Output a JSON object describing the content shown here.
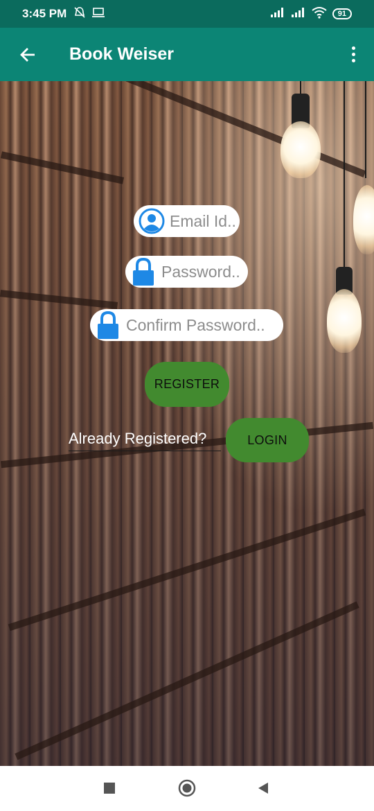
{
  "status_bar": {
    "time": "3:45 PM",
    "battery": "91",
    "icons": [
      "alarm-off-icon",
      "laptop-icon",
      "signal-icon",
      "signal-icon",
      "wifi-icon",
      "battery-icon"
    ]
  },
  "app_bar": {
    "title": "Book Weiser",
    "icons": [
      "back-arrow-icon",
      "overflow-menu-icon"
    ]
  },
  "form": {
    "email": {
      "placeholder": "Email Id..",
      "icon": "user-icon"
    },
    "password": {
      "placeholder": "Password..",
      "icon": "lock-icon"
    },
    "confirm_password": {
      "placeholder": "Confirm Password..",
      "icon": "lock-icon"
    },
    "register_label": "REGISTER",
    "already_registered": "Already Registered?",
    "login_label": "LOGIN"
  },
  "colors": {
    "status_bar": "#0b6b5d",
    "app_bar": "#0c8575",
    "button": "#428a2f",
    "icon_blue": "#1e88e5"
  },
  "nav_bar": {
    "icons": [
      "recents-square-icon",
      "home-circle-icon",
      "back-triangle-icon"
    ]
  }
}
